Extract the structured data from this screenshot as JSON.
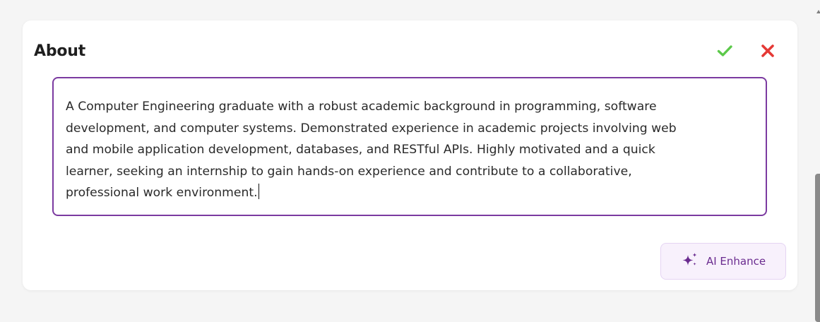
{
  "about": {
    "title": "About",
    "confirm_icon": "check-icon",
    "cancel_icon": "close-icon",
    "text": "A Computer Engineering graduate with a robust academic background in programming, software\ndevelopment, and computer systems. Demonstrated experience in academic projects involving web\nand mobile application development, databases, and RESTful APIs. Highly motivated and a quick\nlearner, seeking an internship to gain hands-on experience and contribute to a collaborative,\nprofessional work environment.",
    "ai_button_label": "AI Enhance",
    "ai_icon": "sparkles-icon"
  },
  "colors": {
    "accent": "#7b3aa0",
    "confirm": "#5cc94a",
    "cancel": "#e53935",
    "ai_button_bg": "#f8f1fc",
    "ai_button_text": "#6a2b8f"
  }
}
